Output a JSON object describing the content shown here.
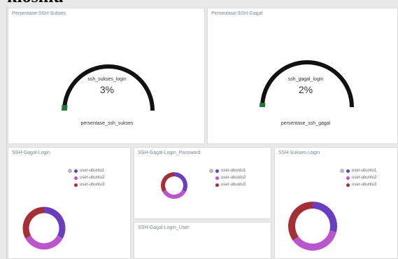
{
  "page_title_fragment": "kiosmu.",
  "colors": {
    "gauge_arc": "#111111",
    "gauge_fill": "#1f7a3a",
    "series1": "#6a3fbf",
    "series2": "#bb55cc",
    "series3": "#a52f36"
  },
  "panels": {
    "ssh_sukses_gauge": {
      "title": "Persentase-SSH-Sukses",
      "metric_name": "ssh_sukses_login",
      "value_text": "3%",
      "value": 3,
      "bottom_label": "persentase_ssh_sukses"
    },
    "ssh_gagal_gauge": {
      "title": "Persentase-SSH-Gagal",
      "metric_name": "ssh_gagal_login",
      "value_text": "2%",
      "value": 2,
      "bottom_label": "persentase_ssh_gagal"
    },
    "ssh_gagal_login": {
      "title": "SSH-Gagal-Login",
      "legend": [
        "user-ubuntu1",
        "user-ubuntu2",
        "user-ubuntu3"
      ],
      "shares": [
        0.33,
        0.34,
        0.33
      ]
    },
    "ssh_gagal_login_password": {
      "title": "SSH-Gagal-Login_Password",
      "legend": [
        "user-ubuntu1",
        "user-ubuntu2",
        "user-ubuntu3"
      ],
      "shares": [
        0.33,
        0.34,
        0.33
      ]
    },
    "ssh_gagal_login_user": {
      "title": "SSH-Gagal-Login_User"
    },
    "ssh_sukses_login": {
      "title": "SSH-Sukses-Login",
      "legend": [
        "user-ubuntu1",
        "user-ubuntu2",
        "user-ubuntu3"
      ],
      "shares": [
        0.29,
        0.36,
        0.35
      ]
    }
  }
}
